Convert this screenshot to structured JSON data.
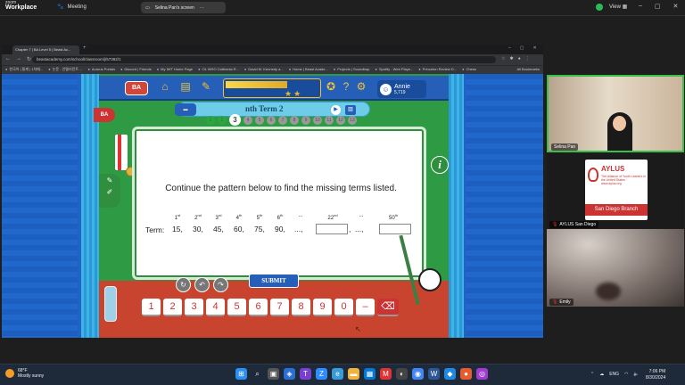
{
  "zoom": {
    "brand_small": "zoom",
    "brand": "Workplace",
    "meeting_label": "Meeting",
    "share_label": "Selina Pan's screen",
    "view_label": "View"
  },
  "browser": {
    "tab_title": "Chapter 7 | BA Level 5 | Beast Ac...",
    "url": "beastacademy.com/school/classroom/j/57382/1",
    "bookmarks": [
      "한국어 | 통계 | 1차매...",
      "논문 - 인텔리전트 ...",
      "Aureus Portals",
      "Discord | Friends",
      "My IWT Home Page",
      "OL WHO California R...",
      "David M. Kennedy a...",
      "Home | Beast Acade...",
      "Projects | Soundtrap",
      "Spotify - Web Playe...",
      "Princeton Review D...",
      "Chess"
    ],
    "all_bookmarks": "All Bookmarks"
  },
  "game": {
    "logo": "BA",
    "user_name": "Annie",
    "user_coins": "5,719",
    "progress": 0.65,
    "lesson_title": "nth Term 2",
    "left_badge": "BA",
    "question_numbers": [
      "1",
      "2",
      "3",
      "4",
      "5",
      "6",
      "7",
      "8",
      "9",
      "10",
      "11",
      "12",
      "13"
    ],
    "current_question": 3,
    "question": "Continue the pattern below to find the missing terms listed.",
    "term_label": "Term:",
    "ordinals": [
      {
        "n": "1",
        "s": "st"
      },
      {
        "n": "2",
        "s": "nd"
      },
      {
        "n": "3",
        "s": "rd"
      },
      {
        "n": "4",
        "s": "th"
      },
      {
        "n": "5",
        "s": "th"
      },
      {
        "n": "6",
        "s": "th"
      }
    ],
    "dots": "...",
    "ord_22": {
      "n": "22",
      "s": "nd"
    },
    "ord_50": {
      "n": "50",
      "s": "th"
    },
    "values": [
      "15,",
      "30,",
      "45,",
      "60,",
      "75,",
      "90,"
    ],
    "ellipsis_comma": "...,",
    "comma": ",",
    "submit_label": "SUBMIT",
    "info_label": "i",
    "keypad": [
      "1",
      "2",
      "3",
      "4",
      "5",
      "6",
      "7",
      "8",
      "9",
      "0",
      "–"
    ],
    "backspace": "⌫"
  },
  "participants": [
    {
      "name": "Selina Pan",
      "muted": false
    },
    {
      "name": "AYLUS San Diego",
      "muted": true
    },
    {
      "name": "Emily",
      "muted": true
    }
  ],
  "aylus": {
    "name": "AYLUS",
    "tagline": "The Alliance of Youth Leaders in the United States · www.aylus.org",
    "branch": "San Diego Branch"
  },
  "taskbar": {
    "temp": "68°F",
    "weather": "Mostly sunny",
    "lang": "ENG",
    "time": "7:06 PM",
    "date": "8/30/2024"
  }
}
